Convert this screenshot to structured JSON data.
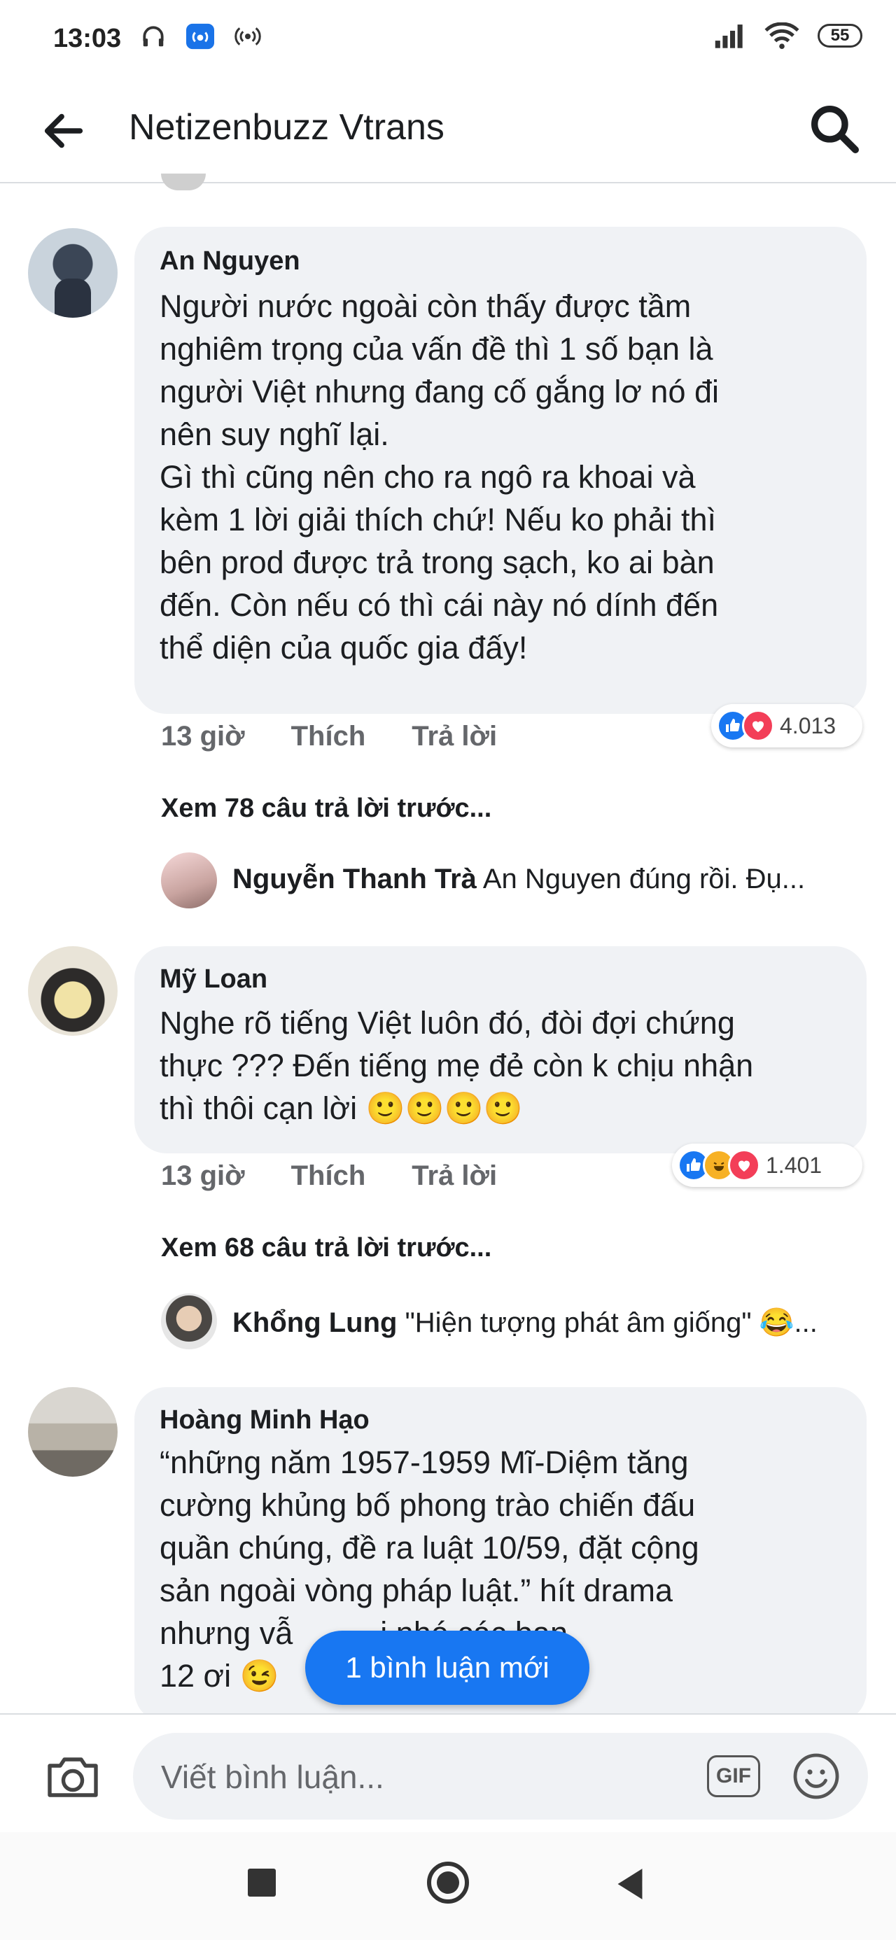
{
  "status_bar": {
    "time": "13:03",
    "battery": "55"
  },
  "header": {
    "title": "Netizenbuzz Vtrans"
  },
  "comments": [
    {
      "author": "An Nguyen",
      "text": "Người nước ngoài còn thấy được tầm\nnghiêm trọng của vấn đề thì 1 số bạn là\nngười Việt nhưng đang cố gắng lơ nó đi\nnên suy nghĩ lại.\nGì thì cũng nên cho ra ngô ra khoai và\nkèm 1 lời giải thích chứ! Nếu ko phải thì\nbên prod được trả trong sạch, ko ai bàn\nđến. Còn nếu có thì cái này nó dính đến\nthể diện của quốc gia đấy!",
      "time": "13 giờ",
      "like_label": "Thích",
      "reply_label": "Trả lời",
      "reactions": [
        "like",
        "love"
      ],
      "reaction_count": "4.013",
      "view_more": "Xem 78 câu trả lời trước...",
      "reply_preview": {
        "author": "Nguyễn Thanh Trà",
        "text": "An Nguyen đúng rồi. Đụ..."
      }
    },
    {
      "author": "Mỹ Loan",
      "text": "Nghe rõ tiếng Việt luôn đó, đòi đợi chứng\nthực ??? Đến tiếng mẹ đẻ còn k chịu nhận\nthì thôi cạn lời 🙂🙂🙂🙂",
      "time": "13 giờ",
      "like_label": "Thích",
      "reply_label": "Trả lời",
      "reactions": [
        "like",
        "haha",
        "love"
      ],
      "reaction_count": "1.401",
      "view_more": "Xem 68 câu trả lời trước...",
      "reply_preview": {
        "author": "Khổng Lung",
        "text": "\"Hiện tượng phát âm giống\" 😂..."
      }
    },
    {
      "author": "Hoàng Minh Hạo",
      "text": "“những năm 1957-1959 Mĩ-Diệm tăng\ncường khủng bố phong trào chiến đấu\nquần chúng, đề ra luật 10/59, đặt cộng\nsản ngoài vòng pháp luật.” hít drama\nnhưng vẫ          i nhé các bạn\n12 ơi 😉"
    }
  ],
  "new_comments_pill": "1 bình luận mới",
  "composer": {
    "placeholder": "Viết bình luận...",
    "gif_label": "GIF"
  },
  "colors": {
    "accent": "#1877f2",
    "bubble": "#f0f2f5",
    "love": "#f33e58",
    "haha": "#f7b125"
  }
}
